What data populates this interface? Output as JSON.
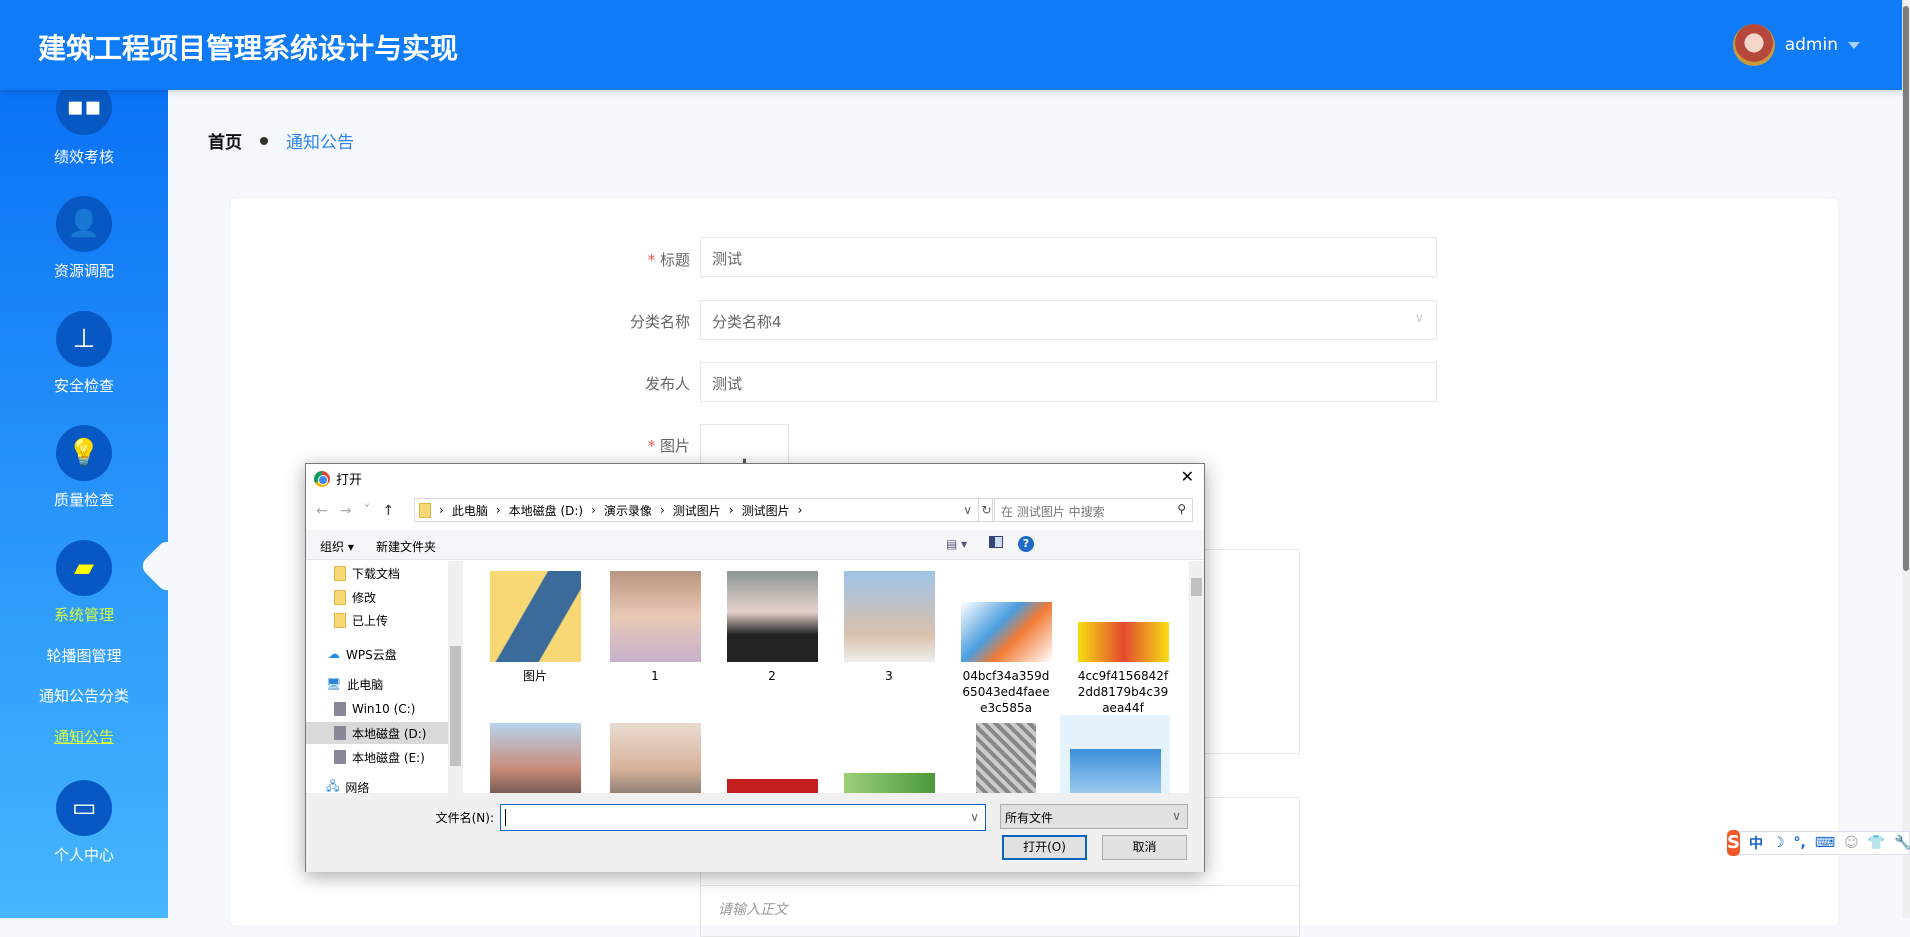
{
  "header": {
    "title": "建筑工程项目管理系统设计与实现",
    "username": "admin"
  },
  "sidebar": {
    "items": [
      {
        "label": "绩效考核",
        "icon": "grid-icon"
      },
      {
        "label": "资源调配",
        "icon": "user-icon"
      },
      {
        "label": "安全检查",
        "icon": "stamp-icon"
      },
      {
        "label": "质量检查",
        "icon": "lightbulb-icon"
      },
      {
        "label": "系统管理",
        "icon": "wallet-icon"
      },
      {
        "label": "个人中心",
        "icon": "card-icon"
      }
    ],
    "sub_items": [
      "轮播图管理",
      "通知公告分类",
      "通知公告"
    ]
  },
  "breadcrumb": {
    "home": "首页",
    "current": "通知公告"
  },
  "form": {
    "title_label": "标题",
    "title_value": "测试",
    "category_label": "分类名称",
    "category_value": "分类名称4",
    "publisher_label": "发布人",
    "publisher_value": "测试",
    "image_label": "图片",
    "required_mark": "*",
    "editor_placeholder": "请输入正文"
  },
  "dialog": {
    "title": "打开",
    "path": [
      "此电脑",
      "本地磁盘 (D:)",
      "演示录像",
      "测试图片",
      "测试图片"
    ],
    "search_placeholder": "在 测试图片 中搜索",
    "organize": "组织 ▾",
    "new_folder": "新建文件夹",
    "nav": [
      "下载文档",
      "修改",
      "已上传",
      "WPS云盘",
      "此电脑",
      "Win10 (C:)",
      "本地磁盘 (D:)",
      "本地磁盘 (E:)",
      "网络"
    ],
    "files": [
      "图片",
      "1",
      "2",
      "3",
      "04bcf34a359d65043ed4faeee3c585a",
      "4cc9f4156842f2dd8179b4c39aea44f"
    ],
    "filename_label": "文件名(N):",
    "filename_value": "",
    "filter": "所有文件",
    "open": "打开(O)",
    "cancel": "取消"
  },
  "ime": {
    "lang": "中"
  }
}
